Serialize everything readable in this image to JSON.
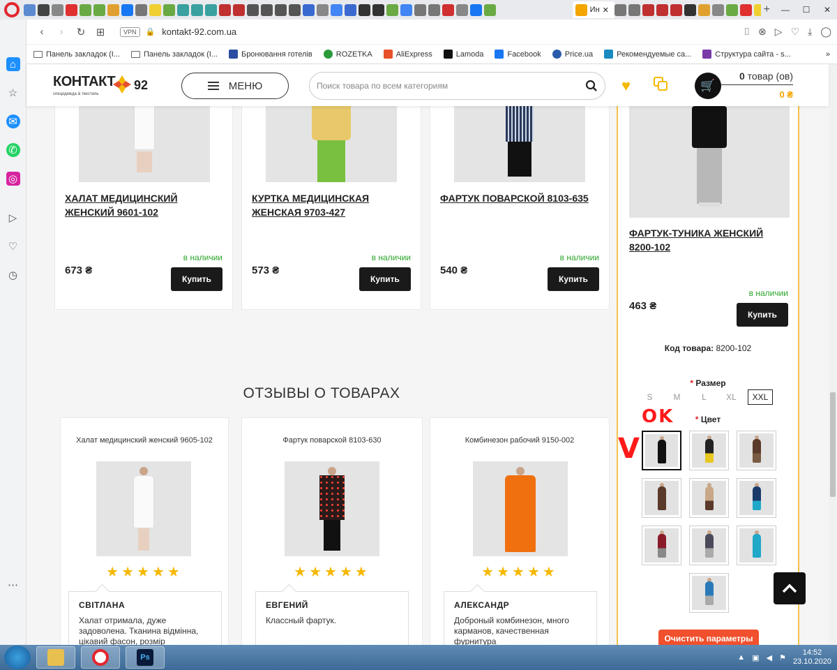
{
  "browser": {
    "active_tab_label": "Ин",
    "url": "kontakt-92.com.ua",
    "vpn_label": "VPN",
    "bookmarks": [
      {
        "label": "Панель закладок (I...",
        "kind": "folder"
      },
      {
        "label": "Панель закладок (I...",
        "kind": "folder"
      },
      {
        "label": "Бронювання готелів",
        "color": "#2a4fa0"
      },
      {
        "label": "ROZETKA",
        "color": "#2a9a3a"
      },
      {
        "label": "AliExpress",
        "color": "#e8502a"
      },
      {
        "label": "Lamoda",
        "color": "#111111"
      },
      {
        "label": "Facebook",
        "color": "#1877f2"
      },
      {
        "label": "Price.ua",
        "color": "#2a5aaa"
      },
      {
        "label": "Рекомендуемые са...",
        "color": "#1a8abf"
      },
      {
        "label": "Структура сайта - s...",
        "color": "#7a3aa8"
      }
    ],
    "bookmarks_more": "»"
  },
  "header": {
    "logo_text": "КОНТАКТ",
    "logo_number": "92",
    "logo_tagline": "спецодежда & текстиль",
    "menu_label": "МЕНЮ",
    "search_placeholder": "Поиск товара по всем категориям",
    "cart_count": "0",
    "cart_count_suffix": " товар (ов)",
    "cart_sum": "0 ₴",
    "colors": {
      "accent": "#f5b800",
      "brand_orange": "#f5a500"
    }
  },
  "products": [
    {
      "title": "ХАЛАТ МЕДИЦИНСКИЙ ЖЕНСКИЙ 9601-102",
      "stock": "в наличии",
      "price": "673 ₴",
      "buy": "Купить"
    },
    {
      "title": "КУРТКА МЕДИЦИНСКАЯ ЖЕНСКАЯ 9703-427",
      "stock": "в наличии",
      "price": "573 ₴",
      "buy": "Купить"
    },
    {
      "title": "ФАРТУК ПОВАРСКОЙ 8103-635",
      "stock": "в наличии",
      "price": "540 ₴",
      "buy": "Купить"
    }
  ],
  "detail": {
    "title": "ФАРТУК-ТУНИКА ЖЕНСКИЙ 8200-102",
    "stock": "в наличии",
    "price": "463 ₴",
    "buy": "Купить",
    "sku_label": "Код товара:",
    "sku_value": "8200-102",
    "required_mark": "*",
    "size_label": "Размер",
    "sizes": [
      "S",
      "M",
      "L",
      "XL",
      "XXL"
    ],
    "selected_size": "XXL",
    "color_label": "Цвет",
    "clear_label": "Очистить параметры"
  },
  "annotations": {
    "ok": "OK",
    "check": "V"
  },
  "reviews": {
    "section_title": "ОТЗЫВЫ О ТОВАРАХ",
    "items": [
      {
        "product": "Халат медицинский женский 9605-102",
        "rating": 5,
        "author": "СВІТЛАНА",
        "text": "Халат отримала, дуже задоволена. Тканина відмінна, цікавий фасон, розмір"
      },
      {
        "product": "Фартук поварской 8103-630",
        "rating": 5,
        "author": "ЕВГЕНИЙ",
        "text": "Классный фартук."
      },
      {
        "product": "Комбинезон рабочий 9150-002",
        "rating": 5,
        "author": "АЛЕКСАНДР",
        "text": "Доброный комбинезон, много карманов, качественная фурнитура"
      }
    ]
  },
  "taskbar": {
    "time": "14:52",
    "date": "23.10.2020"
  }
}
